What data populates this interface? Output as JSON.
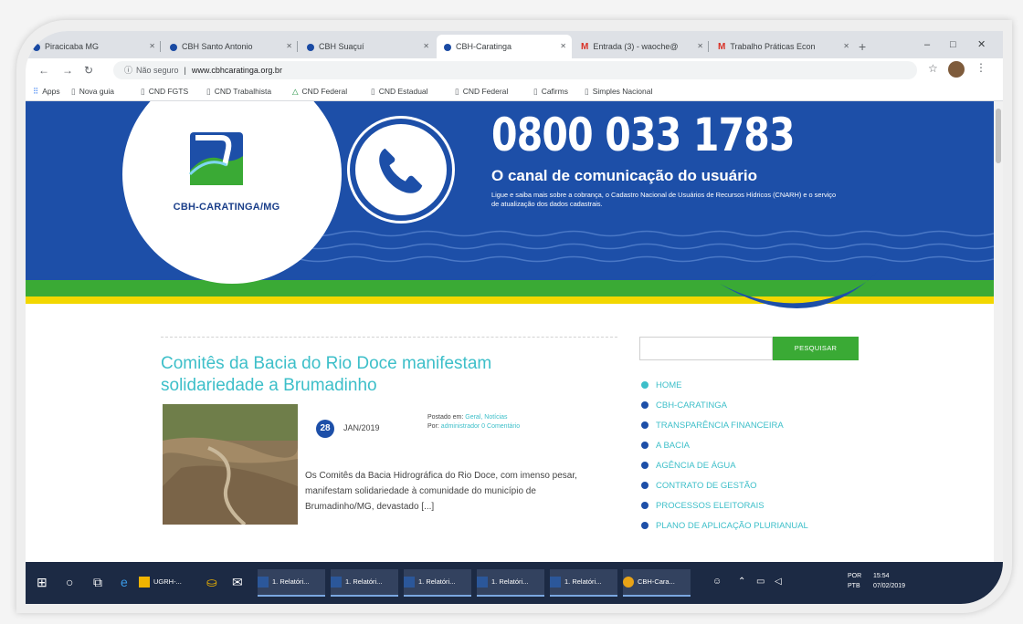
{
  "browser": {
    "tabs": [
      {
        "label": "Piracicaba MG",
        "icon": "site-favicon"
      },
      {
        "label": "CBH Santo Antonio",
        "icon": "site-favicon"
      },
      {
        "label": "CBH Suaçuí",
        "icon": "site-favicon"
      },
      {
        "label": "CBH-Caratinga",
        "icon": "site-favicon",
        "active": true
      },
      {
        "label": "Entrada (3) - waoche@",
        "icon": "gmail-icon"
      },
      {
        "label": "Trabalho Práticas Econ",
        "icon": "gmail-icon"
      }
    ],
    "new_tab": "+",
    "window_controls": {
      "minimize": "–",
      "maximize": "□",
      "close": "✕"
    },
    "address": {
      "security": "Não seguro",
      "url": "www.cbhcaratinga.org.br"
    },
    "bookmarks": [
      {
        "label": "Apps",
        "icon": "apps-grid-icon"
      },
      {
        "label": "Nova guia",
        "icon": "page-icon"
      },
      {
        "label": "CND FGTS",
        "icon": "page-icon"
      },
      {
        "label": "CND Trabalhista",
        "icon": "page-icon"
      },
      {
        "label": "CND Federal",
        "icon": "drive-icon"
      },
      {
        "label": "CND Estadual",
        "icon": "page-icon"
      },
      {
        "label": "CND Federal",
        "icon": "page-icon"
      },
      {
        "label": "Cafirms",
        "icon": "page-icon"
      },
      {
        "label": "Simples Nacional",
        "icon": "page-icon"
      }
    ]
  },
  "site": {
    "logo_text": "CBH-CARATINGA/MG",
    "phone": {
      "number": "0800 033 1783",
      "subtitle": "O canal de comunicação do usuário",
      "description": "Ligue e saiba mais sobre a cobrança, o Cadastro Nacional de Usuários de Recursos Hídricos (CNARH) e o serviço de atualização dos dados cadastrais."
    },
    "post": {
      "title": "Comitês da Bacia do Rio Doce manifestam solidariedade a Brumadinho",
      "day": "28",
      "month_year": "JAN/2019",
      "posted_in_label": "Postado em:",
      "categories": "Geral, Notícias",
      "by_label": "Por:",
      "author": "administrador",
      "comments": "0 Comentário",
      "excerpt": "Os Comitês da Bacia Hidrográfica do Rio Doce, com imenso pesar, manifestam solidariedade à comunidade do município de Brumadinho/MG, devastado [...]"
    },
    "search_button": "PESQUISAR",
    "menu": [
      {
        "label": "HOME",
        "active": true
      },
      {
        "label": "CBH-CARATINGA"
      },
      {
        "label": "TRANSPARÊNCIA FINANCEIRA"
      },
      {
        "label": "A BACIA"
      },
      {
        "label": "AGÊNCIA DE ÁGUA"
      },
      {
        "label": "CONTRATO DE GESTÃO"
      },
      {
        "label": "PROCESSOS ELEITORAIS"
      },
      {
        "label": "PLANO DE APLICAÇÃO PLURIANUAL"
      }
    ],
    "colors": {
      "brand_blue": "#1d4fa8",
      "brand_green": "#3aaa35",
      "brand_yellow": "#f2d700",
      "accent_teal": "#3dbfc9"
    }
  },
  "taskbar": {
    "apps": [
      {
        "label": "UGRH-...",
        "icon": "folder-icon"
      },
      {
        "label": "1. Relatóri...",
        "icon": "word-icon"
      },
      {
        "label": "1. Relatóri...",
        "icon": "word-icon"
      },
      {
        "label": "1. Relatóri...",
        "icon": "word-icon"
      },
      {
        "label": "1. Relatóri...",
        "icon": "word-icon"
      },
      {
        "label": "1. Relatóri...",
        "icon": "word-icon"
      },
      {
        "label": "CBH-Cara...",
        "icon": "chrome-icon"
      }
    ],
    "tray": {
      "lang1": "POR",
      "lang2": "PTB",
      "time": "15:54",
      "date": "07/02/2019"
    }
  }
}
